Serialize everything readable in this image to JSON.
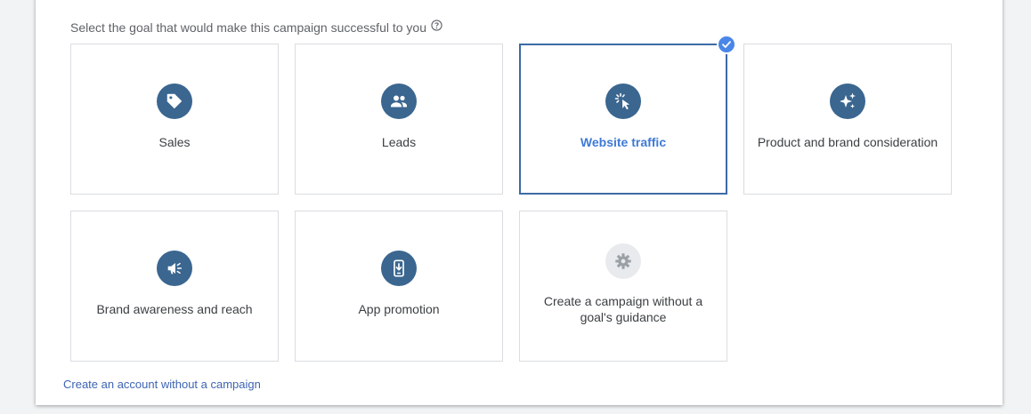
{
  "prompt": {
    "text": "Select the goal that would make this campaign successful to you"
  },
  "goals": [
    {
      "label": "Sales",
      "icon": "tag-icon",
      "selected": false
    },
    {
      "label": "Leads",
      "icon": "people-icon",
      "selected": false
    },
    {
      "label": "Website traffic",
      "icon": "cursor-click-icon",
      "selected": true
    },
    {
      "label": "Product and brand consideration",
      "icon": "sparkle-icon",
      "selected": false
    },
    {
      "label": "Brand awareness and reach",
      "icon": "megaphone-icon",
      "selected": false
    },
    {
      "label": "App promotion",
      "icon": "phone-download-icon",
      "selected": false
    },
    {
      "label": "Create a campaign without a goal's guidance",
      "icon": "gear-icon",
      "selected": false
    }
  ],
  "footer": {
    "link_text": "Create an account without a campaign"
  },
  "colors": {
    "accent": "#3a6690",
    "selected_border": "#3c6ba5",
    "selected_text": "#3e7ad6",
    "check": "#4a86e8",
    "link": "#3e64b3"
  }
}
